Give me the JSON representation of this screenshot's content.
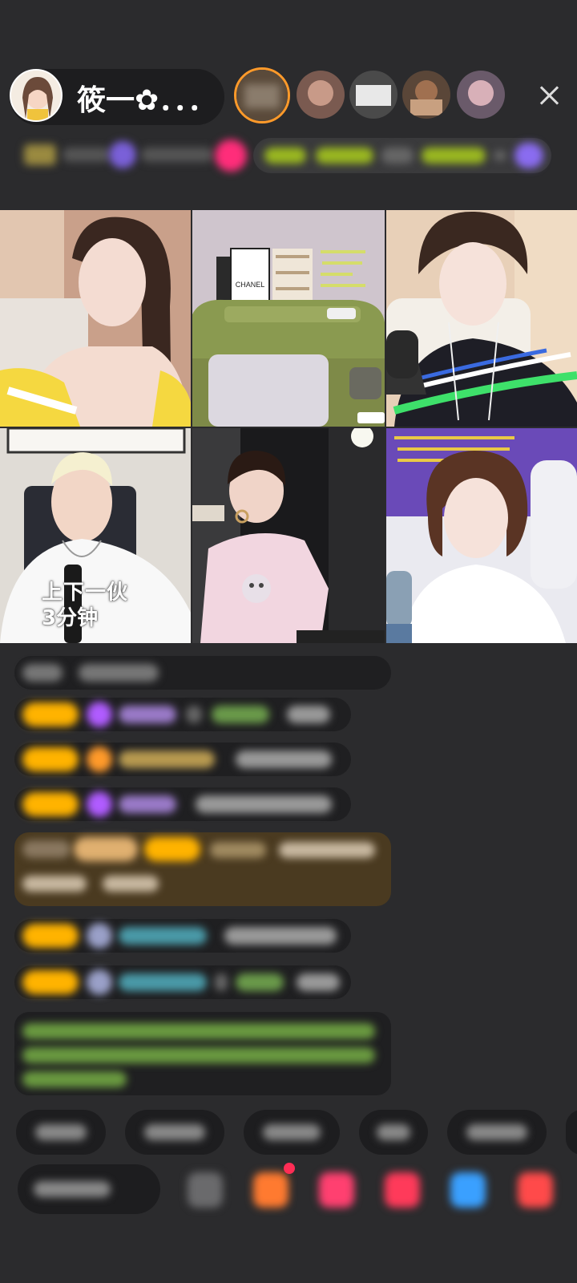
{
  "header": {
    "host_name": "筱一✿．．．",
    "close_icon": "close-icon"
  },
  "video_tiles": [
    {
      "id": "tile-1"
    },
    {
      "id": "tile-2",
      "sign_text": "CHANEL"
    },
    {
      "id": "tile-3"
    },
    {
      "id": "tile-4",
      "overlay_text_line1": "上下一伙",
      "overlay_text_line2": "3分钟"
    },
    {
      "id": "tile-5"
    },
    {
      "id": "tile-6"
    }
  ],
  "colors": {
    "background": "#2b2b2d",
    "level_badge": "#ffb300",
    "accent_orange": "#ff9a2a",
    "accent_green": "#8bc34a",
    "accent_purple": "#b05cff"
  }
}
